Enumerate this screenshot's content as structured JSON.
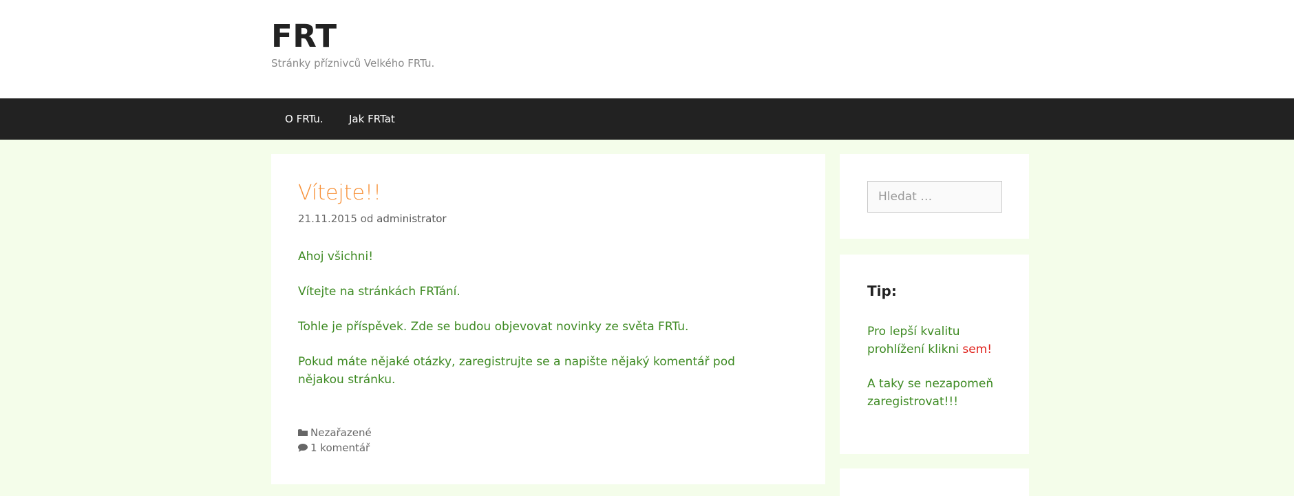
{
  "header": {
    "title": "FRT",
    "tagline": "Stránky příznivců Velkého FRTu."
  },
  "nav": {
    "items": [
      "O FRTu.",
      "Jak FRTat"
    ]
  },
  "post": {
    "title": "Vítejte!!",
    "date": "21.11.2015",
    "by": "od",
    "author": "administrator",
    "paragraphs": [
      "Ahoj všichni!",
      "Vítejte na stránkách FRTání.",
      "Tohle je příspěvek. Zde se budou objevovat novinky ze světa FRTu.",
      "Pokud máte nějaké otázky, zaregistrujte se a napište nějaký komentář pod nějakou stránku."
    ],
    "category": "Nezařazené",
    "comments": "1 komentář",
    "icons": [
      "folder-icon",
      "comment-icon"
    ]
  },
  "sidebar": {
    "search_placeholder": "Hledat …",
    "tip": {
      "title": "Tip:",
      "text_before": "Pro lepší kvalitu prohlížení klikni",
      "link": "sem!",
      "text2": "A taky se nezapomeň zaregistrovat!!!"
    }
  },
  "colors": {
    "page_bg": "#f4fdea",
    "nav_bg": "#222222",
    "post_title": "#f7923a",
    "body_text": "#3d8a22",
    "link_red": "#e0201a"
  }
}
